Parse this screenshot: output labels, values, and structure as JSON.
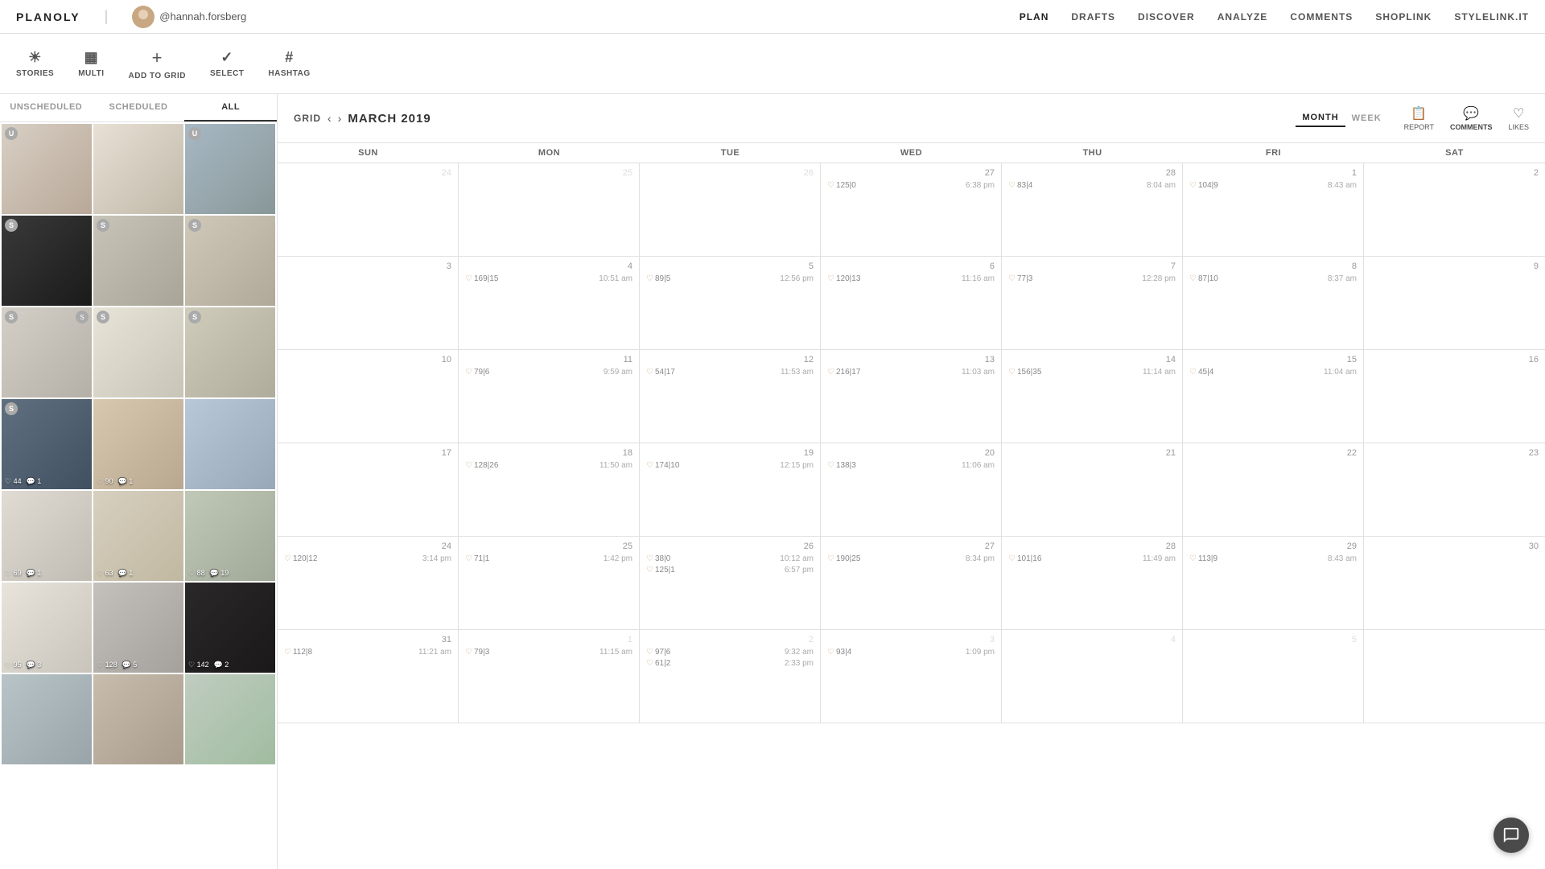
{
  "logo": "PLANOLY",
  "user": {
    "handle": "@hannah.forsberg",
    "avatar_bg": "#c8a882"
  },
  "nav": {
    "links": [
      "PLAN",
      "DRAFTS",
      "DISCOVER",
      "ANALYZE",
      "COMMENTS",
      "SHOPLINK",
      "STYLELINK.IT"
    ],
    "active": "PLAN"
  },
  "toolbar": {
    "items": [
      {
        "id": "stories",
        "label": "STORIES",
        "icon": "☀"
      },
      {
        "id": "multi",
        "label": "MULTI",
        "icon": "▦"
      },
      {
        "id": "add-to-grid",
        "label": "ADD TO GRID",
        "icon": "+"
      },
      {
        "id": "select",
        "label": "SELECT",
        "icon": "✓"
      },
      {
        "id": "hashtag",
        "label": "HASHTAG",
        "icon": "#"
      }
    ]
  },
  "sidebar": {
    "tabs": [
      "UNSCHEDULED",
      "SCHEDULED",
      "ALL"
    ],
    "active_tab": "ALL",
    "images": [
      {
        "id": 1,
        "badge": "U",
        "color": "c1",
        "likes": null,
        "comments": null
      },
      {
        "id": 2,
        "badge": null,
        "color": "c2",
        "likes": null,
        "comments": null
      },
      {
        "id": 3,
        "badge": "U",
        "color": "c3",
        "likes": null,
        "comments": null
      },
      {
        "id": 4,
        "badge": "S",
        "color": "c4",
        "likes": null,
        "comments": null
      },
      {
        "id": 5,
        "badge": "S",
        "color": "c5",
        "likes": null,
        "comments": null
      },
      {
        "id": 6,
        "badge": "S",
        "color": "c6",
        "likes": null,
        "comments": null
      },
      {
        "id": 7,
        "badge": "S",
        "color": "c7",
        "likes": null,
        "comments": null
      },
      {
        "id": 8,
        "badge": "S",
        "color": "c8",
        "likes": null,
        "comments": null
      },
      {
        "id": 9,
        "badge": "S",
        "color": "c9",
        "likes": null,
        "comments": null
      },
      {
        "id": 10,
        "badge": "S",
        "color": "c10",
        "likes": "44",
        "comments": "1"
      },
      {
        "id": 11,
        "badge": null,
        "color": "c11",
        "likes": "90",
        "comments": "1"
      },
      {
        "id": 12,
        "badge": null,
        "color": "c12",
        "likes": null,
        "comments": null
      },
      {
        "id": 13,
        "badge": null,
        "color": "c13",
        "likes": "69",
        "comments": "1"
      },
      {
        "id": 14,
        "badge": null,
        "color": "c14",
        "likes": "63",
        "comments": "1"
      },
      {
        "id": 15,
        "badge": null,
        "color": "c15",
        "likes": "88",
        "comments": "19"
      },
      {
        "id": 16,
        "badge": null,
        "color": "c16",
        "likes": "95",
        "comments": "3"
      },
      {
        "id": 17,
        "badge": null,
        "color": "c17",
        "likes": "128",
        "comments": "5"
      },
      {
        "id": 18,
        "badge": null,
        "color": "c18",
        "likes": "142",
        "comments": "2"
      }
    ]
  },
  "calendar": {
    "title": "MARCH 2019",
    "nav_prev": "‹",
    "nav_next": "›",
    "views": [
      "MONTH",
      "WEEK"
    ],
    "active_view": "MONTH",
    "day_headers": [
      "SUN",
      "MON",
      "TUE",
      "WED",
      "THU",
      "FRI",
      "SAT"
    ],
    "right_icons": [
      "REPORT",
      "COMMENTS",
      "LIKES"
    ],
    "weeks": [
      {
        "days": [
          {
            "num": "24",
            "other": true,
            "events": []
          },
          {
            "num": "25",
            "other": true,
            "events": []
          },
          {
            "num": "26",
            "other": true,
            "events": []
          },
          {
            "num": "27",
            "other": false,
            "events": [
              {
                "likes": "125",
                "comments": "0",
                "time": "6:38 pm"
              }
            ]
          },
          {
            "num": "28",
            "other": false,
            "events": [
              {
                "likes": "83",
                "comments": "4",
                "time": "8:04 am"
              }
            ]
          },
          {
            "num": "1",
            "other": false,
            "events": [
              {
                "likes": "104",
                "comments": "9",
                "time": "8:43 am"
              }
            ]
          },
          {
            "num": "2",
            "other": false,
            "events": []
          }
        ]
      },
      {
        "days": [
          {
            "num": "3",
            "other": false,
            "events": []
          },
          {
            "num": "4",
            "other": false,
            "events": [
              {
                "likes": "169",
                "comments": "15",
                "time": "10:51 am"
              }
            ]
          },
          {
            "num": "5",
            "other": false,
            "events": [
              {
                "likes": "89",
                "comments": "5",
                "time": "12:56 pm"
              }
            ]
          },
          {
            "num": "6",
            "other": false,
            "events": [
              {
                "likes": "120",
                "comments": "13",
                "time": "11:16 am"
              }
            ]
          },
          {
            "num": "7",
            "other": false,
            "events": [
              {
                "likes": "77",
                "comments": "3",
                "time": "12:28 pm"
              }
            ]
          },
          {
            "num": "8",
            "other": false,
            "events": [
              {
                "likes": "87",
                "comments": "10",
                "time": "8:37 am"
              }
            ]
          },
          {
            "num": "9",
            "other": false,
            "events": []
          }
        ]
      },
      {
        "days": [
          {
            "num": "10",
            "other": false,
            "events": []
          },
          {
            "num": "11",
            "other": false,
            "events": [
              {
                "likes": "79",
                "comments": "6",
                "time": "9:59 am"
              }
            ]
          },
          {
            "num": "12",
            "other": false,
            "events": [
              {
                "likes": "54",
                "comments": "17",
                "time": "11:53 am"
              }
            ]
          },
          {
            "num": "13",
            "other": false,
            "events": [
              {
                "likes": "216",
                "comments": "17",
                "time": "11:03 am"
              }
            ]
          },
          {
            "num": "14",
            "other": false,
            "events": [
              {
                "likes": "156",
                "comments": "35",
                "time": "11:14 am"
              }
            ]
          },
          {
            "num": "15",
            "other": false,
            "events": [
              {
                "likes": "45",
                "comments": "4",
                "time": "11:04 am"
              }
            ]
          },
          {
            "num": "16",
            "other": false,
            "events": []
          }
        ]
      },
      {
        "days": [
          {
            "num": "17",
            "other": false,
            "events": []
          },
          {
            "num": "18",
            "other": false,
            "events": [
              {
                "likes": "128",
                "comments": "26",
                "time": "11:50 am"
              }
            ]
          },
          {
            "num": "19",
            "other": false,
            "events": [
              {
                "likes": "174",
                "comments": "10",
                "time": "12:15 pm"
              }
            ]
          },
          {
            "num": "20",
            "other": false,
            "events": [
              {
                "likes": "138",
                "comments": "3",
                "time": "11:06 am"
              }
            ]
          },
          {
            "num": "21",
            "other": false,
            "events": []
          },
          {
            "num": "22",
            "other": false,
            "events": []
          },
          {
            "num": "23",
            "other": false,
            "events": []
          }
        ]
      },
      {
        "days": [
          {
            "num": "24",
            "other": false,
            "events": [
              {
                "likes": "120",
                "comments": "12",
                "time": "3:14 pm"
              }
            ]
          },
          {
            "num": "25",
            "other": false,
            "events": [
              {
                "likes": "71",
                "comments": "1",
                "time": "1:42 pm"
              }
            ]
          },
          {
            "num": "26",
            "other": false,
            "events": [
              {
                "likes": "38",
                "comments": "0",
                "time": "10:12 am"
              },
              {
                "likes": "125",
                "comments": "1",
                "time": "6:57 pm"
              }
            ]
          },
          {
            "num": "27",
            "other": false,
            "events": [
              {
                "likes": "190",
                "comments": "25",
                "time": "8:34 pm"
              }
            ]
          },
          {
            "num": "28",
            "other": false,
            "events": [
              {
                "likes": "101",
                "comments": "16",
                "time": "11:49 am"
              }
            ]
          },
          {
            "num": "29",
            "other": false,
            "events": [
              {
                "likes": "113",
                "comments": "9",
                "time": "8:43 am"
              }
            ]
          },
          {
            "num": "30",
            "other": false,
            "events": []
          }
        ]
      },
      {
        "days": [
          {
            "num": "31",
            "other": false,
            "events": [
              {
                "likes": "112",
                "comments": "8",
                "time": "11:21 am"
              }
            ]
          },
          {
            "num": "1",
            "other": true,
            "events": [
              {
                "likes": "79",
                "comments": "3",
                "time": "11:15 am"
              }
            ]
          },
          {
            "num": "2",
            "other": true,
            "events": [
              {
                "likes": "97",
                "comments": "6",
                "time": "9:32 am"
              },
              {
                "likes": "61",
                "comments": "2",
                "time": "2:33 pm"
              }
            ]
          },
          {
            "num": "3",
            "other": true,
            "events": [
              {
                "likes": "93",
                "comments": "4",
                "time": "1:09 pm"
              }
            ]
          },
          {
            "num": "4",
            "other": true,
            "events": []
          },
          {
            "num": "5",
            "other": true,
            "events": []
          },
          {
            "num": "",
            "other": true,
            "events": []
          }
        ]
      }
    ]
  }
}
